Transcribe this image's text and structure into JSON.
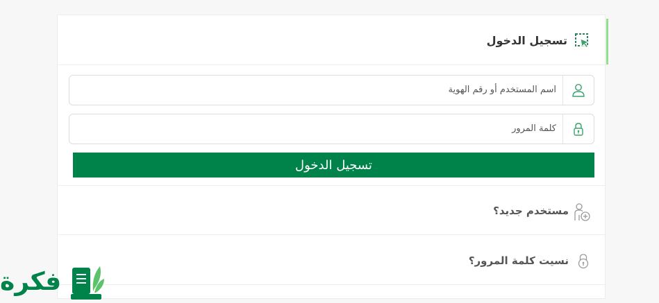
{
  "login": {
    "title": "تسجيل الدخول",
    "username_placeholder": "اسم المستخدم أو رقم الهوية",
    "password_placeholder": "كلمة المرور",
    "submit_label": "تسجيل الدخول"
  },
  "links": {
    "new_user": "مستخدم جديد؟",
    "forgot_password": "نسيت كلمة المرور؟"
  },
  "logo": {
    "text": "فكرة"
  },
  "icons": {
    "header": "cursor-select-icon",
    "username": "user-icon",
    "password": "lock-icon",
    "new_user": "add-user-icon",
    "forgot": "lock-icon"
  },
  "colors": {
    "primary": "#00834b",
    "accent_bar": "#8ee08a",
    "icon_green": "#3aa36b"
  }
}
